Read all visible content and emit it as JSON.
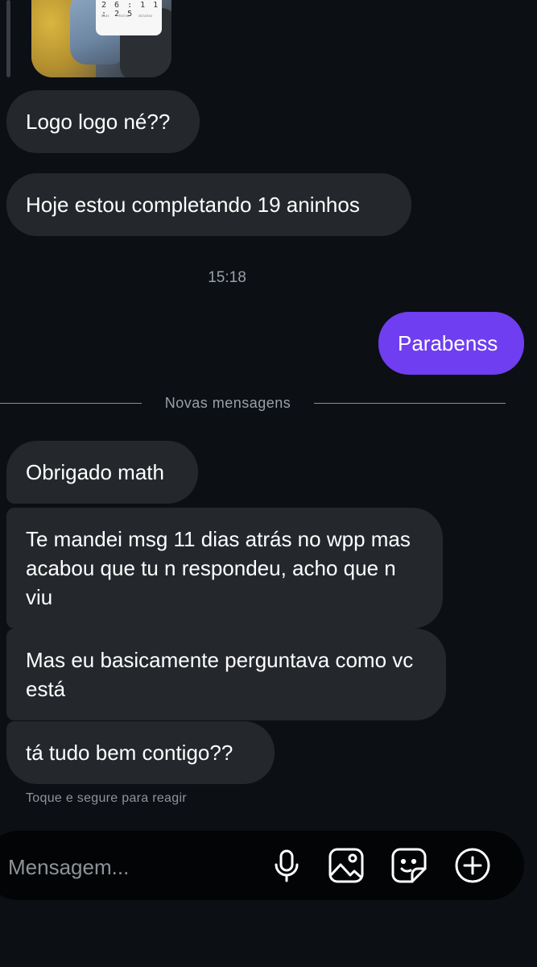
{
  "photo": {
    "countdown": "2 6 : 1 1 : 2 5",
    "units": "dias horas minutos"
  },
  "messages": {
    "m1": "Logo logo né??",
    "m2": "Hoje estou completando 19 aninhos",
    "time": "15:18",
    "m3": "Parabenss",
    "divider": "Novas mensagens",
    "m4": "Obrigado math",
    "m5": "Te mandei msg 11 dias atrás no wpp mas acabou que tu n respondeu, acho que n viu",
    "m6": "Mas eu basicamente perguntava como vc está",
    "m7": "tá tudo bem contigo??",
    "hint": "Toque e segure para reagir"
  },
  "composer": {
    "placeholder": "Mensagem...",
    "icons": [
      "microphone-icon",
      "image-icon",
      "sticker-icon",
      "plus-circle-icon"
    ]
  },
  "colors": {
    "background": "#0c0f14",
    "incoming_bubble": "#24272c",
    "outgoing_bubble": "#6f3ef0",
    "composer": "#030405"
  }
}
